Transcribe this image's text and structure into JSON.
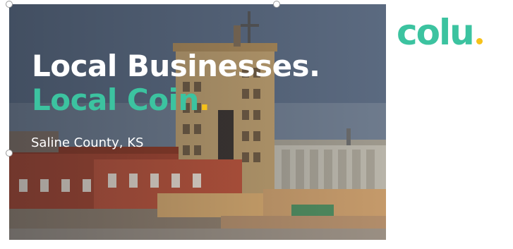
{
  "slide": {
    "headline_line1": "Local Businesses.",
    "headline_line2": "Local Coin",
    "headline_line2_period": ".",
    "location": "Saline County, KS"
  },
  "logo": {
    "text": "colu",
    "dot_color": "#f6c21a"
  },
  "colors": {
    "accent_teal": "#3cc3a0",
    "accent_yellow": "#f6c21a",
    "headline_white": "#ffffff"
  }
}
